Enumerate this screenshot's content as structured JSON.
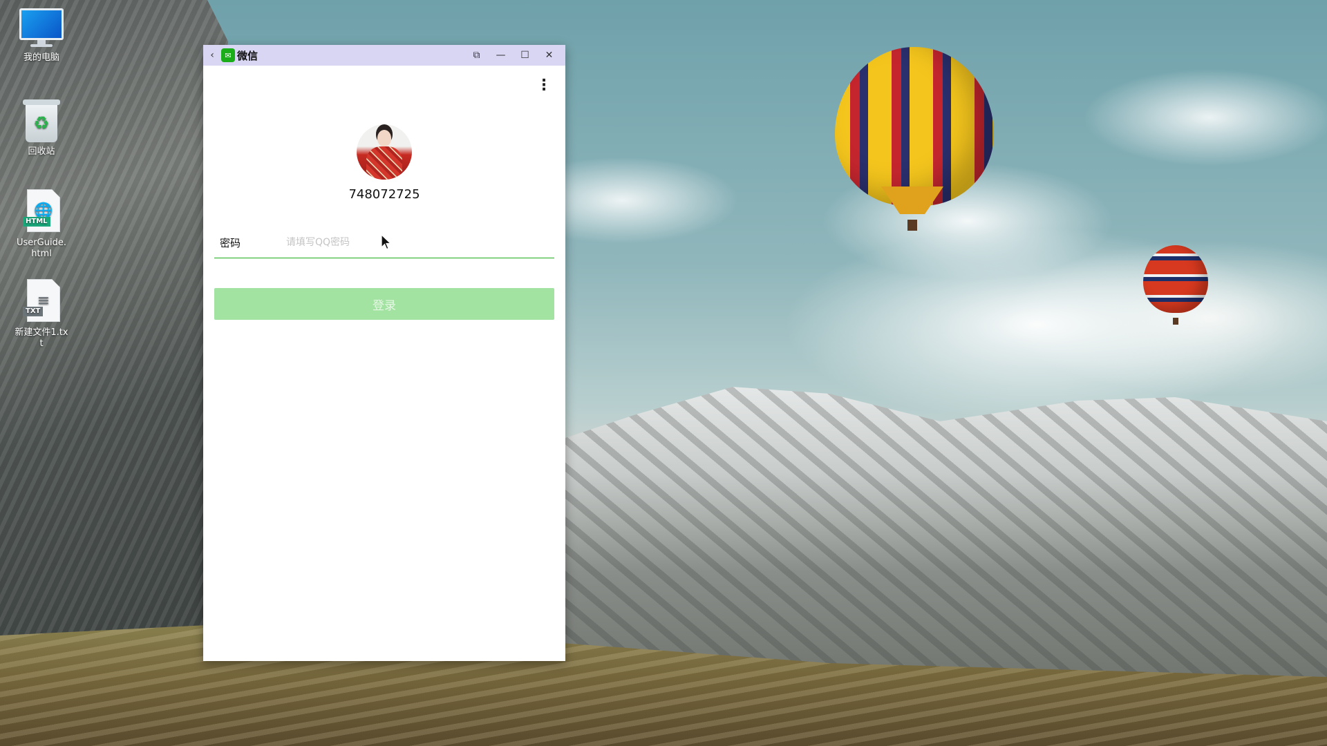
{
  "desktop": {
    "icons": [
      {
        "label": "我的电脑",
        "icon": "computer-icon"
      },
      {
        "label": "回收站",
        "icon": "recycle-bin-icon"
      },
      {
        "label": "UserGuide.html",
        "icon": "html-file-icon",
        "tag": "HTML"
      },
      {
        "label": "新建文件1.txt",
        "icon": "txt-file-icon",
        "tag": "TXT"
      }
    ]
  },
  "window": {
    "title": "微信",
    "app_icon": "wechat-icon",
    "back_icon": "back-arrow-icon",
    "controls": [
      "restore-rotate-icon",
      "minimize-icon",
      "maximize-icon",
      "close-icon"
    ],
    "more_icon": "more-vertical-icon",
    "account": "748072725",
    "password_label": "密码",
    "password_placeholder": "请填写QQ密码",
    "password_value": "",
    "login_label": "登录",
    "accent": "#1aad19",
    "login_bg": "#a3e3a2",
    "titlebar_bg": "#d9d6f4"
  }
}
